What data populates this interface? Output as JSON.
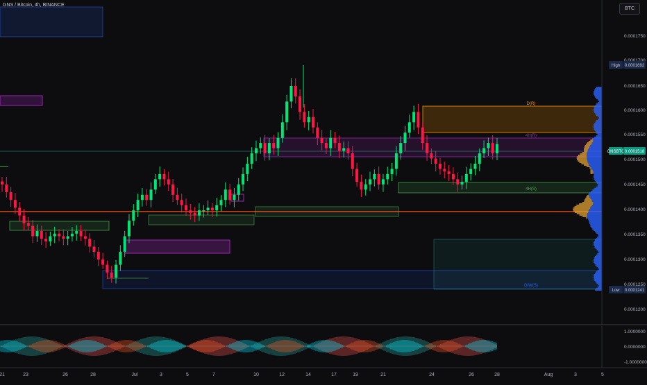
{
  "header": {
    "title": "GNS / Bitcoin, 4h, BINANCE",
    "symbol_button": "BTC"
  },
  "colors": {
    "bg": "#0d0d10",
    "up": "#26a69a",
    "down": "#ef5350",
    "up_bright": "#00e676",
    "down_bright": "#ff1744",
    "purple": "#9c27b0",
    "orange": "#ff9800",
    "green_zone": "#4caf50",
    "blue": "#2962ff",
    "teal": "#26a69a",
    "text": "#b2b5be"
  },
  "price_axis": {
    "ticks": [
      "0.0001750",
      "0.0001700",
      "0.0001650",
      "0.0001600",
      "0.0001550",
      "0.0001500",
      "0.0001450",
      "0.0001400",
      "0.0001350",
      "0.0001300",
      "0.0001250",
      "0.0001200"
    ],
    "high": {
      "tag": "High",
      "value": "0.0001692"
    },
    "current": {
      "tag": "GNSBTC",
      "value": "0.0001518"
    },
    "low": {
      "tag": "Low",
      "value": "0.0001241"
    }
  },
  "osc_axis": {
    "ticks": [
      "1.0000000",
      "0.0000000",
      "-1.0000000"
    ]
  },
  "time_axis": {
    "labels": [
      "21",
      "23",
      "26",
      "28",
      "Jul",
      "3",
      "5",
      "7",
      "10",
      "12",
      "14",
      "17",
      "19",
      "21",
      "24",
      "26",
      "28",
      "Aug",
      "3",
      "5"
    ]
  },
  "zone_labels": {
    "daily_r": "D(R)",
    "h4_r": "4H(R)",
    "h4_s": "4H(S)",
    "dw_s": "D/W(S)"
  },
  "chart_data": {
    "type": "candlestick",
    "ylim": [
      0.000118,
      0.000178
    ],
    "series_close": [
      0.000144,
      0.0001425,
      0.000141,
      0.0001395,
      0.000138,
      0.0001365,
      0.000136,
      0.000134,
      0.000135,
      0.0001335,
      0.000133,
      0.000134,
      0.0001345,
      0.000134,
      0.0001335,
      0.000134,
      0.0001345,
      0.000135,
      0.000134,
      0.0001335,
      0.000132,
      0.000131,
      0.0001295,
      0.0001285,
      0.000127,
      0.000126,
      0.0001285,
      0.000131,
      0.000134,
      0.000137,
      0.000139,
      0.000141,
      0.000142,
      0.000141,
      0.000143,
      0.000145,
      0.000146,
      0.000145,
      0.000144,
      0.000142,
      0.000141,
      0.00014,
      0.000139,
      0.0001385,
      0.000138,
      0.000139,
      0.000139,
      0.0001395,
      0.000139,
      0.00014,
      0.000141,
      0.000143,
      0.000141,
      0.000142,
      0.000144,
      0.000146,
      0.000148,
      0.00015,
      0.000151,
      0.000152,
      0.00015,
      0.000152,
      0.000151,
      0.000153,
      0.000156,
      0.00016,
      0.000163,
      0.000161,
      0.000158,
      0.000156,
      0.000157,
      0.000155,
      0.000153,
      0.000152,
      0.000151,
      0.000153,
      0.000152,
      0.0001505,
      0.000151,
      0.00015,
      0.000147,
      0.0001445,
      0.000143,
      0.000144,
      0.000145,
      0.000146,
      0.000144,
      0.000145,
      0.000146,
      0.000147,
      0.00015,
      0.000152,
      0.000154,
      0.000156,
      0.000158,
      0.000155,
      0.000152,
      0.00015,
      0.000149,
      0.000148,
      0.000147,
      0.0001465,
      0.000146,
      0.000145,
      0.000144,
      0.0001445,
      0.000146,
      0.000147,
      0.000148,
      0.00015,
      0.000151,
      0.000152,
      0.00015,
      0.0001518
    ]
  }
}
